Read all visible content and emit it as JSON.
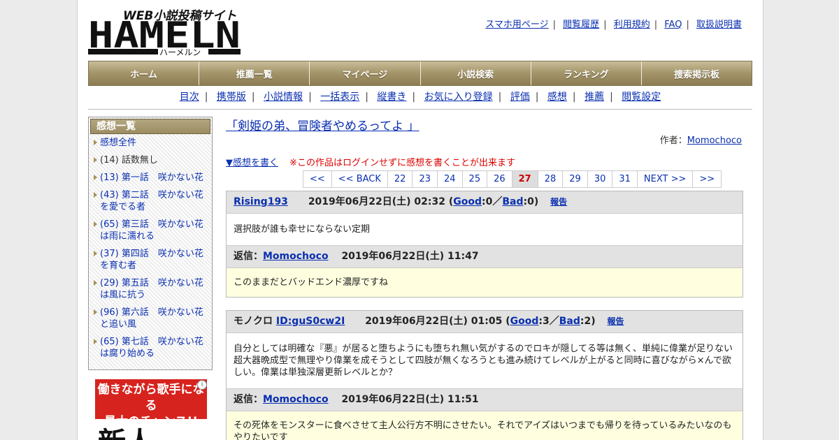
{
  "header": {
    "logo_text": "HAMELN",
    "logo_sub": "WEB小説投稿サイト",
    "logo_kana": "ハーメルン"
  },
  "top_links": [
    "スマホ用ページ",
    "閲覧履歴",
    "利用規約",
    "FAQ",
    "取扱説明書"
  ],
  "global_nav": [
    "ホーム",
    "推薦一覧",
    "マイページ",
    "小説検索",
    "ランキング",
    "捜索掲示板"
  ],
  "sub_nav": [
    "目次",
    "携帯版",
    "小説情報",
    "一括表示",
    "縦書き",
    "お気に入り登録",
    "評価",
    "感想",
    "推薦",
    "閲覧設定"
  ],
  "sidebar": {
    "title": "感想一覧",
    "items": [
      {
        "text": "感想全件",
        "link": true
      },
      {
        "text": "(14) 話数無し",
        "link": false
      },
      {
        "text": "(13) 第一話　咲かない花",
        "link": true
      },
      {
        "text": "(43) 第二話　咲かない花を愛でる者",
        "link": true
      },
      {
        "text": "(65) 第三話　咲かない花は雨に濡れる",
        "link": true
      },
      {
        "text": "(37) 第四話　咲かない花を育む者",
        "link": true
      },
      {
        "text": "(29) 第五話　咲かない花は風に抗う",
        "link": true
      },
      {
        "text": "(96) 第六話　咲かない花と追い風",
        "link": true
      },
      {
        "text": "(65) 第七話　咲かない花は腐り始める",
        "link": true
      }
    ]
  },
  "ad": {
    "line1": "働きながら歌手になる",
    "line2": "最大のチャンス!!",
    "big": "新人"
  },
  "novel": {
    "title": "「剣姫の弟、冒険者やめるってよ 」",
    "author_label": "作者：",
    "author": "Momochoco"
  },
  "notice": {
    "write_link": "▼感想を書く",
    "warning": "※この作品はログインせずに感想を書くことが出来ます"
  },
  "pager": [
    "<<",
    "<< BACK",
    "22",
    "23",
    "24",
    "25",
    "26",
    "27",
    "28",
    "29",
    "30",
    "31",
    "NEXT >>",
    ">>"
  ],
  "pager_current": "27",
  "comments": [
    {
      "user": "Rising193",
      "user_prefix": "",
      "date": "2019年06月22日(土) 02:32",
      "good_label": "Good",
      "good": ":0／",
      "bad_label": "Bad",
      "bad": ":0)",
      "report": "報告",
      "body": "選択肢が誰も幸せにならない定期",
      "reply_label": "返信：",
      "reply_user": "Momochoco",
      "reply_date": "2019年06月22日(土) 11:47",
      "reply_body": "このままだとバッドエンド濃厚ですね"
    },
    {
      "user": "ID:guS0cw2I",
      "user_prefix": "モノクロ ",
      "date": "2019年06月22日(土) 01:05",
      "good_label": "Good",
      "good": ":3／",
      "bad_label": "Bad",
      "bad": ":2)",
      "report": "報告",
      "body": "自分としては明確な『悪』が居ると堕ちようにも堕ちれ無い気がするのでロキが隠してる等は無く、単純に偉業が足りない超大器晩成型で無理やり偉業を成そうとして四肢が無くなろうとも進み続けてレベルが上がると同時に喜びながら×んで欲しい。偉業は単独深層更新レベルとか？",
      "reply_label": "返信：",
      "reply_user": "Momochoco",
      "reply_date": "2019年06月22日(土) 11:51",
      "reply_body": "その死体をモンスターに食べさせて主人公行方不明にさせたい。それでアイズはいつまでも帰りを待っているみたいなのもやりたいです"
    }
  ]
}
